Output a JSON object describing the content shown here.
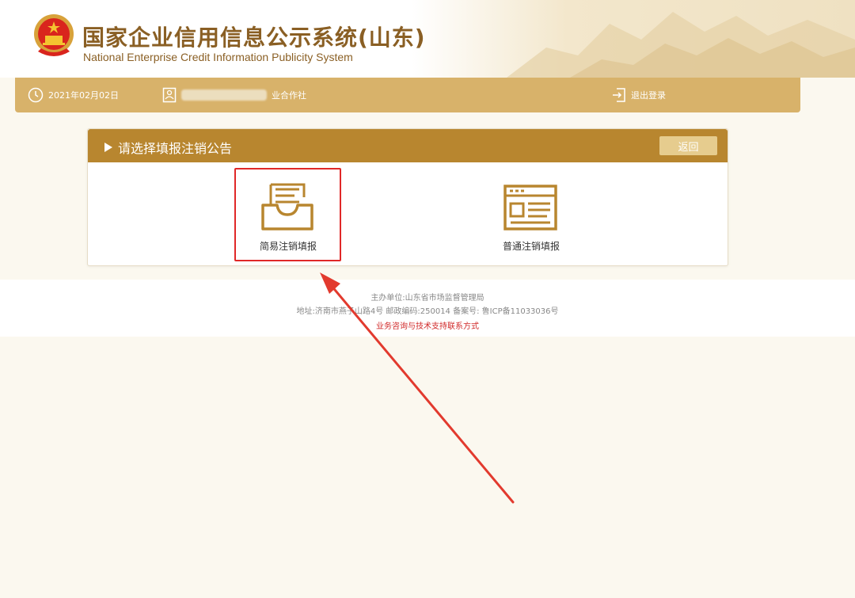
{
  "site": {
    "title": "国家企业信用信息公示系统(山东)",
    "subtitle": "National Enterprise Credit Information Publicity System"
  },
  "infobar": {
    "date": "2021年02月02日",
    "company_suffix": "业合作社",
    "logout": "退出登录"
  },
  "panel": {
    "title": "请选择填报注销公告",
    "back_label": "返回",
    "options": [
      {
        "label": "简易注销填报",
        "icon": "document-tray-icon"
      },
      {
        "label": "普通注销填报",
        "icon": "form-window-icon"
      }
    ]
  },
  "footer": {
    "sponsor": "主办单位:山东省市场监督管理局",
    "address": "地址:济南市燕子山路4号    邮政编码:250014    备案号: 鲁ICP备11033036号",
    "contact": "业务咨询与技术支持联系方式"
  },
  "colors": {
    "brand_brown": "#8a5f24",
    "bar_gold": "#d8b26a",
    "panel_head": "#b8862f",
    "icon_gold": "#b8862f",
    "highlight_red": "#e02828"
  }
}
